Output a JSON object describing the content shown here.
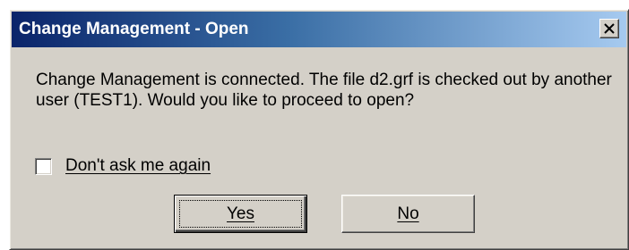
{
  "dialog": {
    "title": "Change Management - Open",
    "close_icon": "close-icon",
    "message": "Change Management is connected. The file d2.grf is checked out by another user (TEST1). Would you like to proceed to open?",
    "checkbox": {
      "label": "Don't ask me again",
      "checked": false
    },
    "buttons": {
      "yes_label": "Yes",
      "no_label": "No"
    }
  }
}
